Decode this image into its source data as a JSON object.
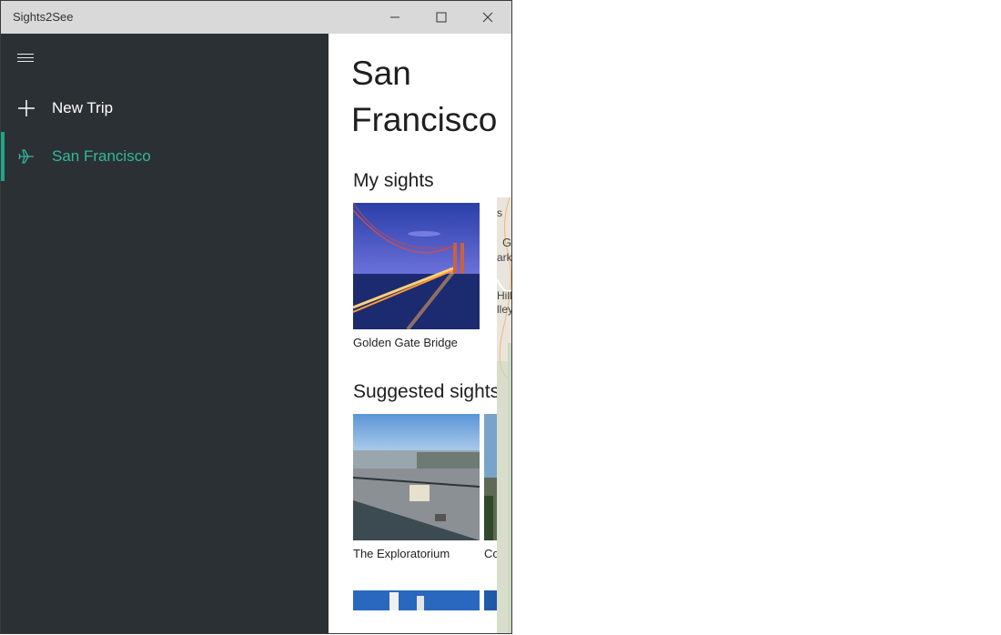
{
  "window": {
    "title": "Sights2See"
  },
  "sidebar": {
    "items": [
      {
        "label": "New Trip",
        "icon": "plus-icon"
      },
      {
        "label": "San Francisco",
        "icon": "airplane-icon",
        "selected": true
      }
    ]
  },
  "colors": {
    "sidebar_bg": "#2b3035",
    "accent": "#21a488",
    "accent_text": "#33b79f",
    "titlebar_bg": "#d9d9d9"
  },
  "main": {
    "title": "San Francisco",
    "my_sights": {
      "heading": "My sights",
      "items": [
        {
          "caption": "Golden Gate Bridge"
        }
      ]
    },
    "suggested_sights": {
      "heading": "Suggested sights",
      "items": [
        {
          "caption": "The Exploratorium"
        },
        {
          "caption": "Co"
        }
      ]
    },
    "map_labels": [
      "s",
      "G",
      "arks",
      "Hill",
      "lley"
    ]
  }
}
